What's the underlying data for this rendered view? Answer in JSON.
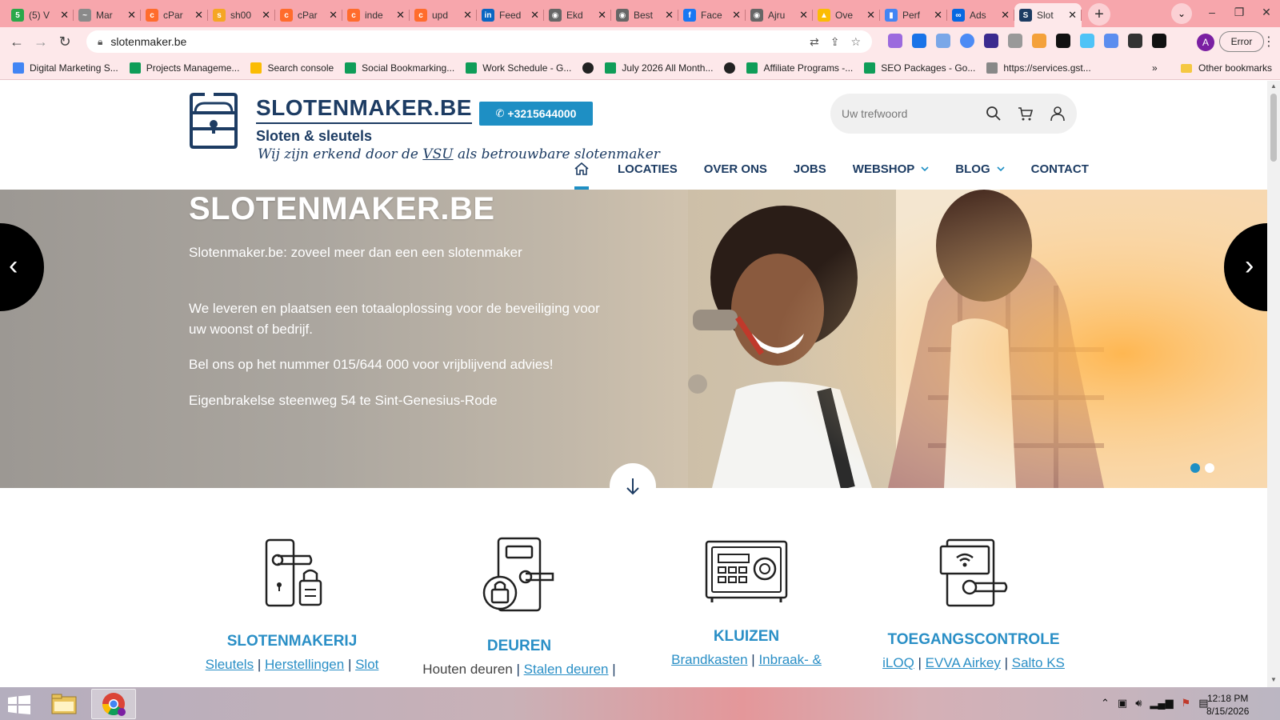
{
  "browser": {
    "tabs": [
      {
        "label": "(5) V",
        "color": "#2aa84a",
        "glyph": "5"
      },
      {
        "label": "Mar",
        "color": "#8a8a8a",
        "glyph": "~"
      },
      {
        "label": "cPar",
        "color": "#ff6c2c",
        "glyph": "c"
      },
      {
        "label": "sh00",
        "color": "#f5a623",
        "glyph": "s"
      },
      {
        "label": "cPar",
        "color": "#ff6c2c",
        "glyph": "c"
      },
      {
        "label": "inde",
        "color": "#ff6c2c",
        "glyph": "c"
      },
      {
        "label": "upd",
        "color": "#ff6c2c",
        "glyph": "c"
      },
      {
        "label": "Feed",
        "color": "#0a66c2",
        "glyph": "in"
      },
      {
        "label": "Ekd",
        "color": "#666666",
        "glyph": "◉"
      },
      {
        "label": "Best",
        "color": "#666666",
        "glyph": "◉"
      },
      {
        "label": "Face",
        "color": "#1877f2",
        "glyph": "f"
      },
      {
        "label": "Ajru",
        "color": "#666666",
        "glyph": "◉"
      },
      {
        "label": "Ove",
        "color": "#fbbc04",
        "glyph": "▲"
      },
      {
        "label": "Perf",
        "color": "#4285f4",
        "glyph": "▮"
      },
      {
        "label": "Ads",
        "color": "#0668e1",
        "glyph": "∞"
      },
      {
        "label": "Slot",
        "color": "#1d3c63",
        "glyph": "S",
        "active": true
      }
    ],
    "url": "slotenmaker.be",
    "error_label": "Error",
    "profile_initial": "A",
    "bookmarks": [
      {
        "label": "Digital Marketing S...",
        "color": "#4285f4"
      },
      {
        "label": "Projects Manageme...",
        "color": "#0f9d58"
      },
      {
        "label": "Search console",
        "color": "#fbbc04"
      },
      {
        "label": "Social Bookmarking...",
        "color": "#0f9d58"
      },
      {
        "label": "Work Schedule - G...",
        "color": "#0f9d58"
      },
      {
        "label": "",
        "color": "#222222"
      },
      {
        "label": "July 2026 All Month...",
        "color": "#0f9d58"
      },
      {
        "label": "",
        "color": "#222222"
      },
      {
        "label": "Affiliate Programs -...",
        "color": "#0f9d58"
      },
      {
        "label": "SEO Packages - Go...",
        "color": "#0f9d58"
      },
      {
        "label": "https://services.gst...",
        "color": "#888888"
      }
    ],
    "more_bookmarks": "»",
    "other_bookmarks": "Other bookmarks"
  },
  "site": {
    "brand": "SLOTENMAKER.BE",
    "brand_sub": "Sloten & sleutels",
    "tagline_pre": "Wij zijn erkend door de ",
    "tagline_vsu": "VSU",
    "tagline_post": " als betrouwbare slotenmaker",
    "phone": "+3215644000",
    "search_placeholder": "Uw trefwoord",
    "nav": [
      {
        "label": "LOCATIES"
      },
      {
        "label": "OVER ONS"
      },
      {
        "label": "JOBS"
      },
      {
        "label": "WEBSHOP",
        "dropdown": true
      },
      {
        "label": "BLOG",
        "dropdown": true
      },
      {
        "label": "CONTACT"
      }
    ]
  },
  "hero": {
    "title": "SLOTENMAKER.BE",
    "line1": "Slotenmaker.be:  zoveel meer dan een een slotenmaker",
    "line2": "We leveren en plaatsen een totaaloplossing voor de beveiliging voor uw woonst of bedrijf.",
    "line3": "Bel ons op het nummer 015/644 000 voor vrijblijvend advies!",
    "line4": "Eigenbrakelse steenweg 54 te Sint-Genesius-Rode",
    "active_slide": 1,
    "slide_count": 2
  },
  "categories": [
    {
      "title": "SLOTENMAKERIJ",
      "links": [
        "Sleutels",
        "Herstellingen",
        "Slot"
      ],
      "icon": "door-handle-padlock-icon"
    },
    {
      "title": "DEUREN",
      "plain": "Houten deuren",
      "links": [
        "Stalen deuren"
      ],
      "icon": "door-lock-icon"
    },
    {
      "title": "KLUIZEN",
      "links": [
        "Brandkasten",
        "Inbraak- &"
      ],
      "icon": "safe-icon"
    },
    {
      "title": "TOEGANGSCONTROLE",
      "links": [
        "iLOQ",
        "EVVA Airkey",
        "Salto KS"
      ],
      "icon": "access-control-icon"
    }
  ],
  "taskbar": {
    "time": "12:18 PM",
    "date": "8/15/2026"
  },
  "colors": {
    "brand_navy": "#1d3c63",
    "accent_blue": "#1e8fc4",
    "chrome_pink": "#f7a6ac"
  }
}
